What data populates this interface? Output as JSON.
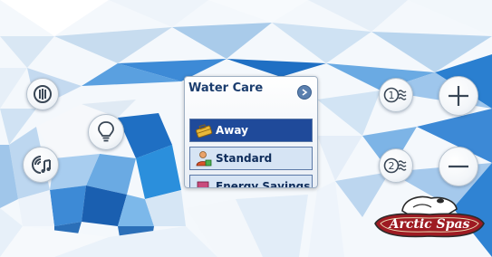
{
  "water_care": {
    "title": "Water Care",
    "options": [
      {
        "label": "Away",
        "selected": true
      },
      {
        "label": "Standard",
        "selected": false
      },
      {
        "label": "Energy Savings",
        "selected": false
      }
    ]
  },
  "brand": {
    "logo_text": "Arctic Spas"
  },
  "colors": {
    "accent": "#1f4a9a",
    "panel_title": "#1b3d6e",
    "background_blue": "#2b8fdc"
  },
  "icons": {
    "jets": "jets-icon",
    "light": "light-bulb-icon",
    "audio": "audio-icon",
    "pump1": "pump-1-icon",
    "pump2": "pump-2-icon",
    "increase": "plus-icon",
    "decrease": "minus-icon"
  }
}
